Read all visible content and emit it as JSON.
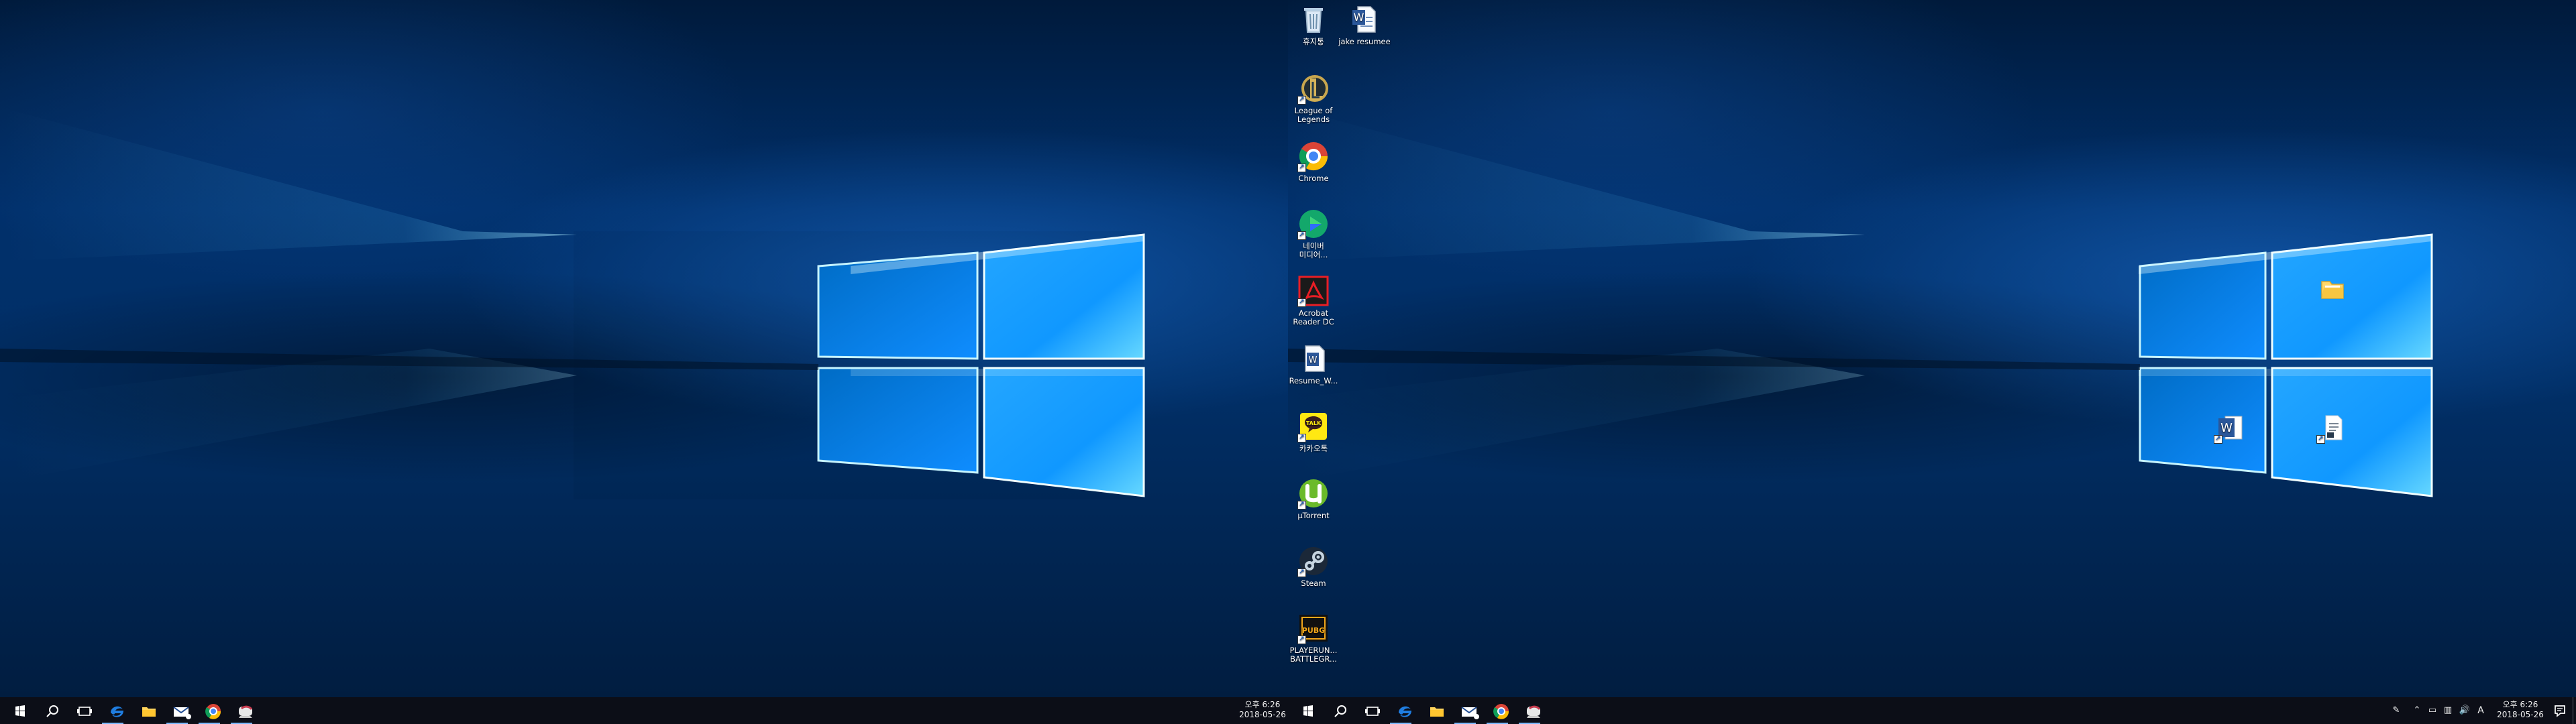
{
  "desktop": {
    "icons": [
      {
        "label": "휴지통",
        "icon": "recycle-bin-icon"
      },
      {
        "label": "jake resumee",
        "icon": "word-document-icon"
      },
      {
        "label": "League of\nLegends",
        "icon": "league-of-legends-icon"
      },
      {
        "label": "Chrome",
        "icon": "chrome-icon"
      },
      {
        "label": "네이버\n미디어...",
        "icon": "naver-media-player-icon"
      },
      {
        "label": "Acrobat\nReader DC",
        "icon": "acrobat-reader-icon"
      },
      {
        "label": "Resume_W...",
        "icon": "word-document-icon"
      },
      {
        "label": "카카오톡",
        "icon": "kakaotalk-icon"
      },
      {
        "label": "µTorrent",
        "icon": "utorrent-icon"
      },
      {
        "label": "Steam",
        "icon": "steam-icon"
      },
      {
        "label": "PLAYERUN...\nBATTLEGR...",
        "icon": "pubg-icon"
      },
      {
        "label": "",
        "icon": "folder-icon"
      },
      {
        "label": "",
        "icon": "word-2016-icon"
      },
      {
        "label": "",
        "icon": "text-file-icon"
      }
    ]
  },
  "taskbars": {
    "left": {
      "buttons": [
        {
          "icon": "windows-start-icon"
        },
        {
          "icon": "search-icon"
        },
        {
          "icon": "task-view-icon"
        },
        {
          "icon": "edge-icon"
        },
        {
          "icon": "file-explorer-icon"
        },
        {
          "icon": "mail-icon"
        },
        {
          "icon": "chrome-icon"
        },
        {
          "icon": "pinned-app-icon"
        }
      ],
      "clock": {
        "time": "오후 6:26",
        "date": "2018-05-26"
      }
    },
    "right": {
      "buttons": [
        {
          "icon": "windows-start-icon"
        },
        {
          "icon": "search-icon"
        },
        {
          "icon": "task-view-icon"
        },
        {
          "icon": "edge-icon"
        },
        {
          "icon": "file-explorer-icon"
        },
        {
          "icon": "mail-icon"
        },
        {
          "icon": "chrome-icon"
        },
        {
          "icon": "pinned-app-icon"
        }
      ],
      "tray": {
        "icons": [
          "pen-workspace-icon",
          "show-hidden-icons-icon",
          "device-icon",
          "network-icon",
          "volume-icon"
        ],
        "ime": "A",
        "time": "오후 6:26",
        "date": "2018-05-26"
      }
    }
  },
  "colors": {
    "taskbar": "#0c0f18",
    "wallpaper_dark": "#001a3b",
    "wallpaper_light": "#53c8ff",
    "accent": "#7ab7ff"
  }
}
